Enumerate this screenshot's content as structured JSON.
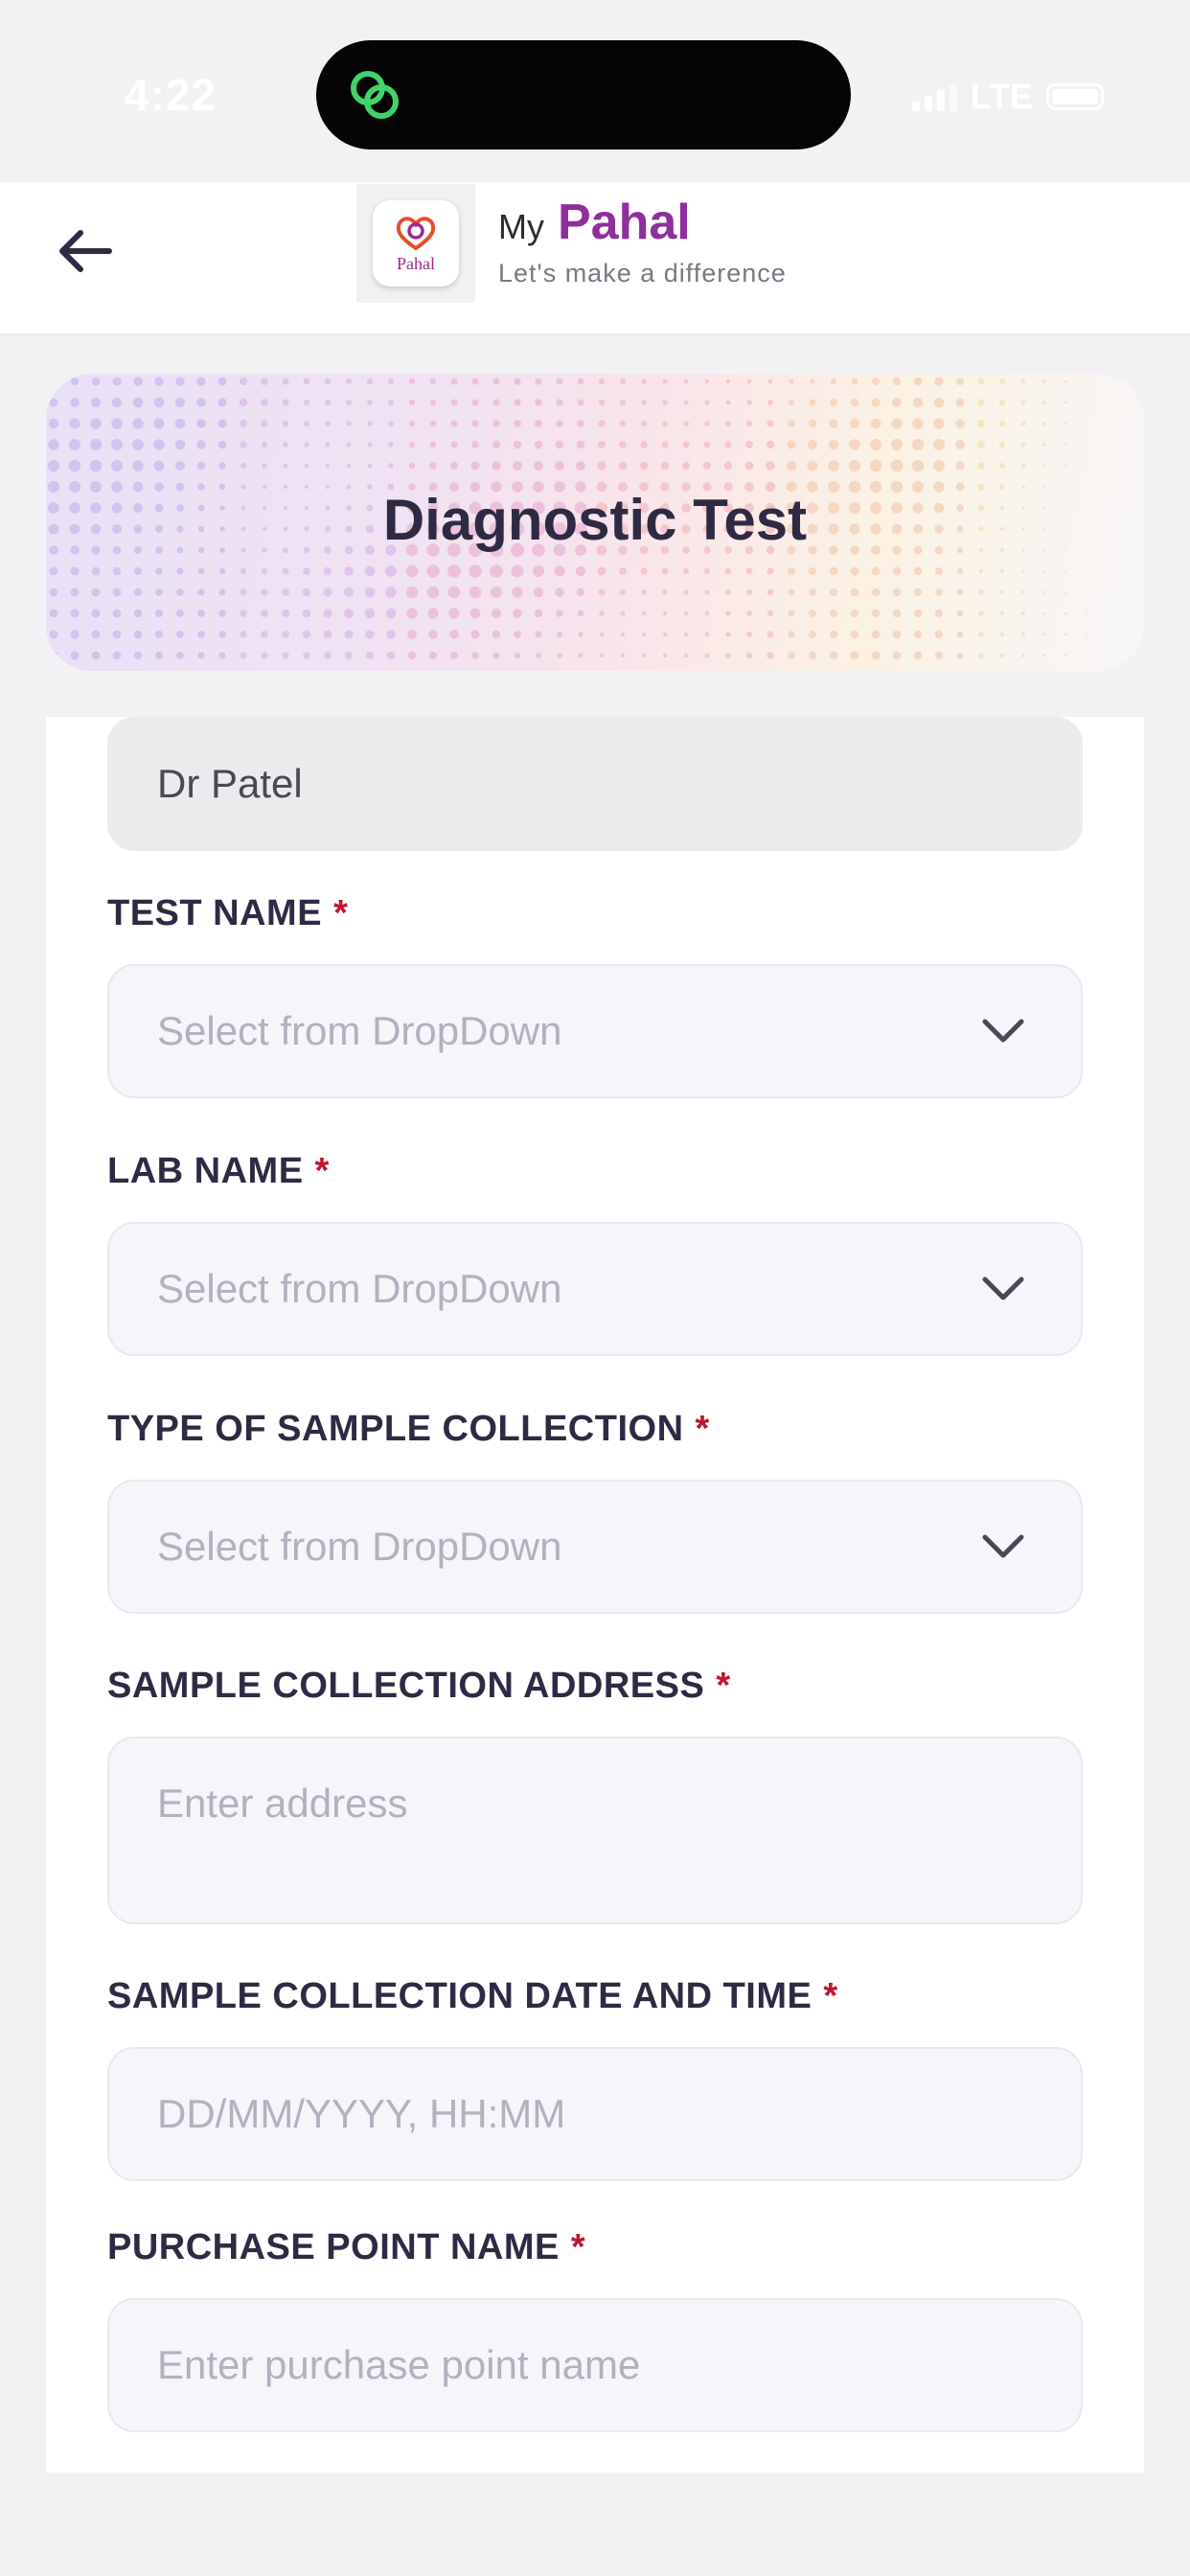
{
  "status_bar": {
    "time": "4:22",
    "network": "LTE",
    "island_icon": "link-rings-icon"
  },
  "header": {
    "back_icon": "arrow-left-icon",
    "logo_text": "Pahal",
    "brand_prefix": "My",
    "brand_name": "Pahal",
    "tagline": "Let's make a difference"
  },
  "banner": {
    "title": "Diagnostic Test"
  },
  "form": {
    "doctor": {
      "value": "Dr Patel"
    },
    "test_name": {
      "label": "TEST NAME",
      "required_mark": "*",
      "placeholder": "Select from DropDown"
    },
    "lab_name": {
      "label": "LAB NAME",
      "required_mark": "*",
      "placeholder": "Select from DropDown"
    },
    "sample_type": {
      "label": "TYPE OF SAMPLE COLLECTION",
      "required_mark": "*",
      "placeholder": "Select from DropDown"
    },
    "address": {
      "label": "SAMPLE COLLECTION ADDRESS",
      "required_mark": "*",
      "placeholder": "Enter address"
    },
    "datetime": {
      "label": "SAMPLE COLLECTION DATE AND TIME",
      "required_mark": "*",
      "placeholder": "DD/MM/YYYY, HH:MM"
    },
    "purchase_point": {
      "label": "PURCHASE POINT NAME",
      "required_mark": "*",
      "placeholder": "Enter purchase point name"
    }
  },
  "colors": {
    "brand": "#8e2f9e",
    "required": "#c0172e",
    "label": "#2f2a44",
    "placeholder": "#b3b0bf"
  }
}
